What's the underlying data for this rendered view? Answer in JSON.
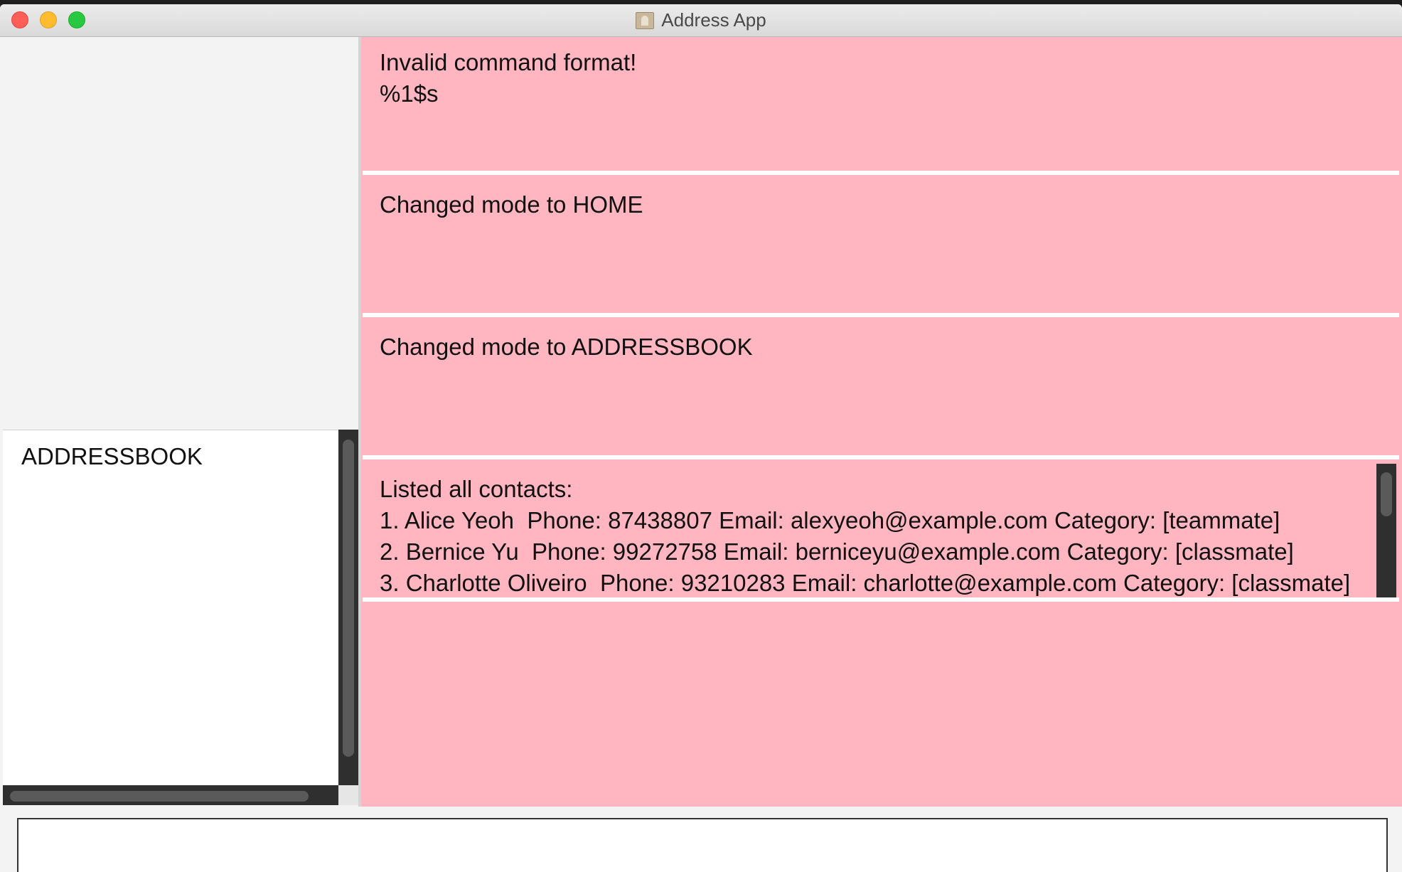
{
  "window": {
    "title": "Address App",
    "app_icon": "address-book-icon"
  },
  "modes": {
    "items": [
      "ADDRESSBOOK"
    ]
  },
  "results": [
    {
      "text": "Invalid command format!\n%1$s"
    },
    {
      "text": "Changed mode to HOME"
    },
    {
      "text": "Changed mode to ADDRESSBOOK"
    },
    {
      "text": "Listed all contacts:\n1. Alice Yeoh  Phone: 87438807 Email: alexyeoh@example.com Category: [teammate]\n2. Bernice Yu  Phone: 99272758 Email: berniceyu@example.com Category: [classmate]\n3. Charlotte Oliveiro  Phone: 93210283 Email: charlotte@example.com Category: [classmate]"
    }
  ],
  "command": {
    "value": "",
    "placeholder": ""
  },
  "colors": {
    "result_background": "#ffb6c1",
    "close": "#ff5f57",
    "minimize": "#febc2e",
    "maximize": "#28c840"
  }
}
